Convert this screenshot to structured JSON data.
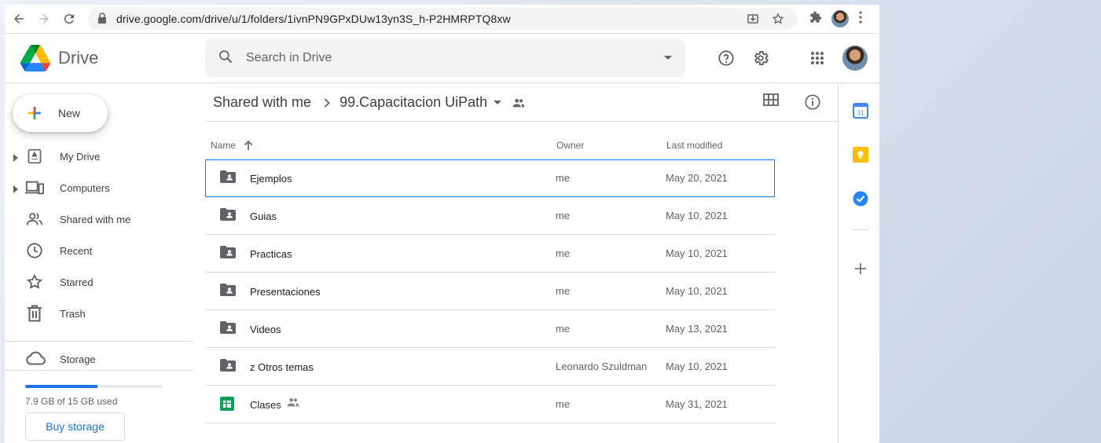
{
  "browser": {
    "url": "drive.google.com/drive/u/1/folders/1ivnPN9GPxDUw13yn3S_h-P2HMRPTQ8xw",
    "icons": [
      "back-icon",
      "forward-icon",
      "reload-icon",
      "lock-icon",
      "install-icon",
      "star-icon",
      "extensions-icon",
      "profile-avatar",
      "menu-kebab-icon"
    ]
  },
  "header": {
    "app_name": "Drive",
    "search_placeholder": "Search in Drive",
    "icons": [
      "help-icon",
      "settings-icon",
      "apps-grid-icon",
      "account-avatar"
    ]
  },
  "sidebar": {
    "new_label": "New",
    "items": [
      {
        "label": "My Drive",
        "icon": "my-drive-icon",
        "expandable": true
      },
      {
        "label": "Computers",
        "icon": "computers-icon",
        "expandable": true
      },
      {
        "label": "Shared with me",
        "icon": "shared-icon",
        "expandable": false
      },
      {
        "label": "Recent",
        "icon": "clock-icon",
        "expandable": false
      },
      {
        "label": "Starred",
        "icon": "star-icon",
        "expandable": false
      },
      {
        "label": "Trash",
        "icon": "trash-icon",
        "expandable": false
      }
    ],
    "storage": {
      "label": "Storage",
      "used_text": "7.9 GB of 15 GB used",
      "used_fraction": 0.527,
      "buy_label": "Buy storage"
    }
  },
  "main": {
    "breadcrumb": {
      "parent": "Shared with me",
      "current": "99.Capacitacion UiPath"
    },
    "columns": {
      "name": "Name",
      "owner": "Owner",
      "modified": "Last modified"
    },
    "rows": [
      {
        "name": "Ejemplos",
        "type": "shared-folder",
        "owner": "me",
        "modified": "May 20, 2021",
        "selected": true
      },
      {
        "name": "Guias",
        "type": "shared-folder",
        "owner": "me",
        "modified": "May 10, 2021"
      },
      {
        "name": "Practicas",
        "type": "shared-folder",
        "owner": "me",
        "modified": "May 10, 2021"
      },
      {
        "name": "Presentaciones",
        "type": "shared-folder",
        "owner": "me",
        "modified": "May 10, 2021"
      },
      {
        "name": "Videos",
        "type": "shared-folder",
        "owner": "me",
        "modified": "May 13, 2021"
      },
      {
        "name": "z Otros temas",
        "type": "shared-folder",
        "owner": "Leonardo Szuldman",
        "modified": "May 10, 2021"
      },
      {
        "name": "Clases",
        "type": "sheets",
        "owner": "me",
        "modified": "May 31, 2021",
        "shared": true
      }
    ]
  },
  "side_panel": {
    "apps": [
      "calendar-icon",
      "keep-icon",
      "tasks-icon",
      "add-addon-icon"
    ],
    "calendar_day": "31"
  },
  "colors": {
    "accent": "#1a73e8",
    "selected_border": "#1a73e8",
    "sheets_green": "#0f9d58",
    "keep_yellow": "#fbbc04"
  }
}
